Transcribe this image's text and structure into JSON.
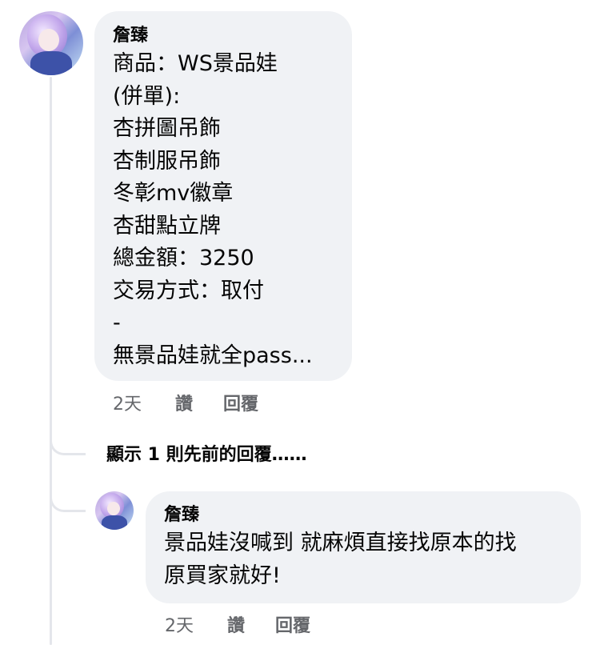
{
  "comment1": {
    "author": "詹臻",
    "lines": [
      "商品：WS景品娃",
      "(併單):",
      "杏拼圖吊飾",
      "杏制服吊飾",
      "冬彰mv徽章",
      "杏甜點立牌",
      "總金額：3250",
      "交易方式：取付",
      "-",
      "無景品娃就全pass..."
    ],
    "time": "2天",
    "like": "讚",
    "reply": "回覆"
  },
  "show_previous": "顯示 1 則先前的回覆……",
  "comment2": {
    "author": "詹臻",
    "lines": [
      "景品娃沒喊到 就麻煩直接找原本的找",
      "原買家就好!"
    ],
    "time": "2天",
    "like": "讚",
    "reply": "回覆"
  }
}
